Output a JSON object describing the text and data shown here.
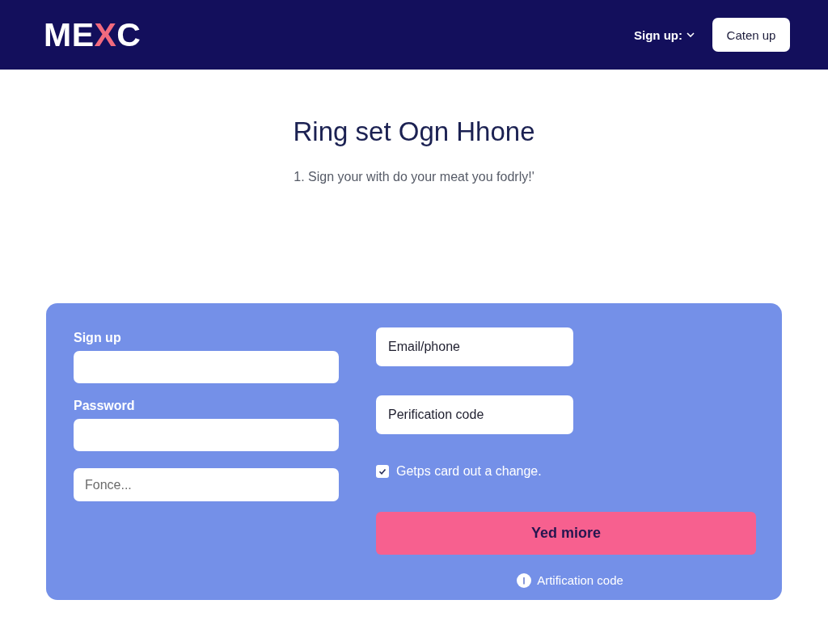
{
  "header": {
    "logo": [
      {
        "text": "ME",
        "highlight": false
      },
      {
        "text": "X",
        "highlight": true
      },
      {
        "text": "C",
        "highlight": false
      }
    ],
    "menu": {
      "label": "Sign up:"
    },
    "button": "Caten up"
  },
  "intro": {
    "title": "Ring set Ogn Hhone",
    "subtitle": "1. Sign your with do your meat you fodrly!'"
  },
  "form": {
    "left_fields": [
      {
        "label": "Sign up"
      },
      {
        "label": "Password"
      },
      {
        "placeholder": "Fonce..."
      }
    ],
    "right_fields": [
      {
        "placeholder": "Email/phone"
      },
      {
        "placeholder": "Perification code"
      }
    ],
    "checkbox": {
      "label": "Getps card out a change.",
      "checked": true
    },
    "submit": "Yed miore",
    "info": "Artification code"
  }
}
